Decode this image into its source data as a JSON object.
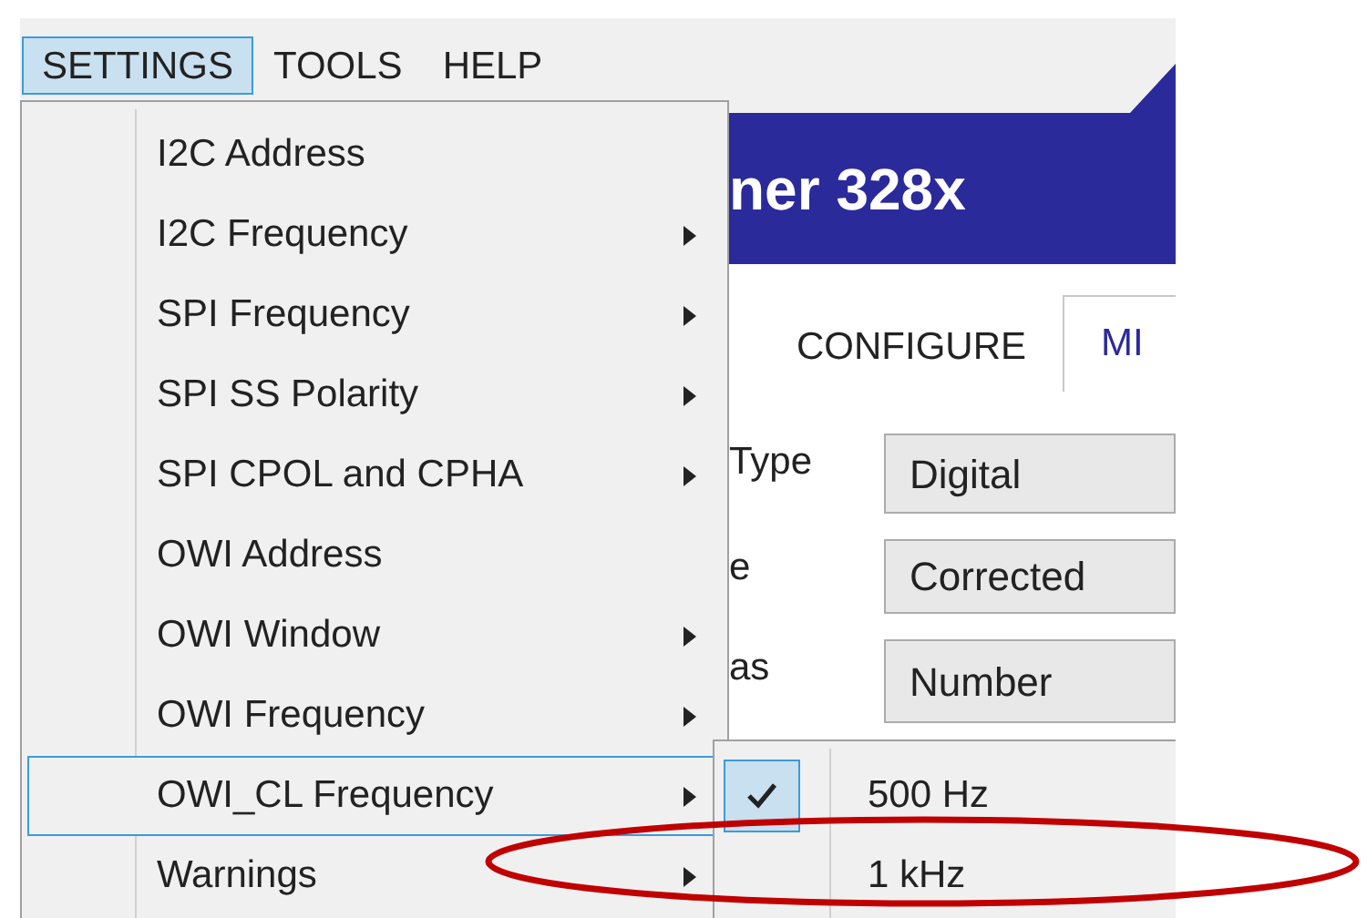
{
  "menu_bar": [
    {
      "label": "SETTINGS",
      "selected": true
    },
    {
      "label": "TOOLS",
      "selected": false
    },
    {
      "label": "HELP",
      "selected": false
    }
  ],
  "banner": {
    "title": "ner 328x"
  },
  "tabs": [
    {
      "label": "CONFIGURE",
      "selected": false
    },
    {
      "label": "MI",
      "selected": true
    }
  ],
  "fields": [
    {
      "label": "Type",
      "value": "Digital"
    },
    {
      "label": "e",
      "value": "Corrected"
    },
    {
      "label": "as",
      "value": "Number"
    }
  ],
  "settings_menu": [
    {
      "label": "I2C Address",
      "submenu": false,
      "selected": false
    },
    {
      "label": "I2C Frequency",
      "submenu": true,
      "selected": false
    },
    {
      "label": "SPI Frequency",
      "submenu": true,
      "selected": false
    },
    {
      "label": "SPI SS Polarity",
      "submenu": true,
      "selected": false
    },
    {
      "label": "SPI CPOL and CPHA",
      "submenu": true,
      "selected": false
    },
    {
      "label": "OWI Address",
      "submenu": false,
      "selected": false
    },
    {
      "label": "OWI Window",
      "submenu": true,
      "selected": false
    },
    {
      "label": "OWI Frequency",
      "submenu": true,
      "selected": false
    },
    {
      "label": "OWI_CL Frequency",
      "submenu": true,
      "selected": true
    },
    {
      "label": "Warnings",
      "submenu": true,
      "selected": false
    }
  ],
  "submenu": [
    {
      "label": "500 Hz",
      "checked": true
    },
    {
      "label": "1 kHz",
      "checked": false
    }
  ],
  "annotation": {
    "kind": "ellipse"
  }
}
